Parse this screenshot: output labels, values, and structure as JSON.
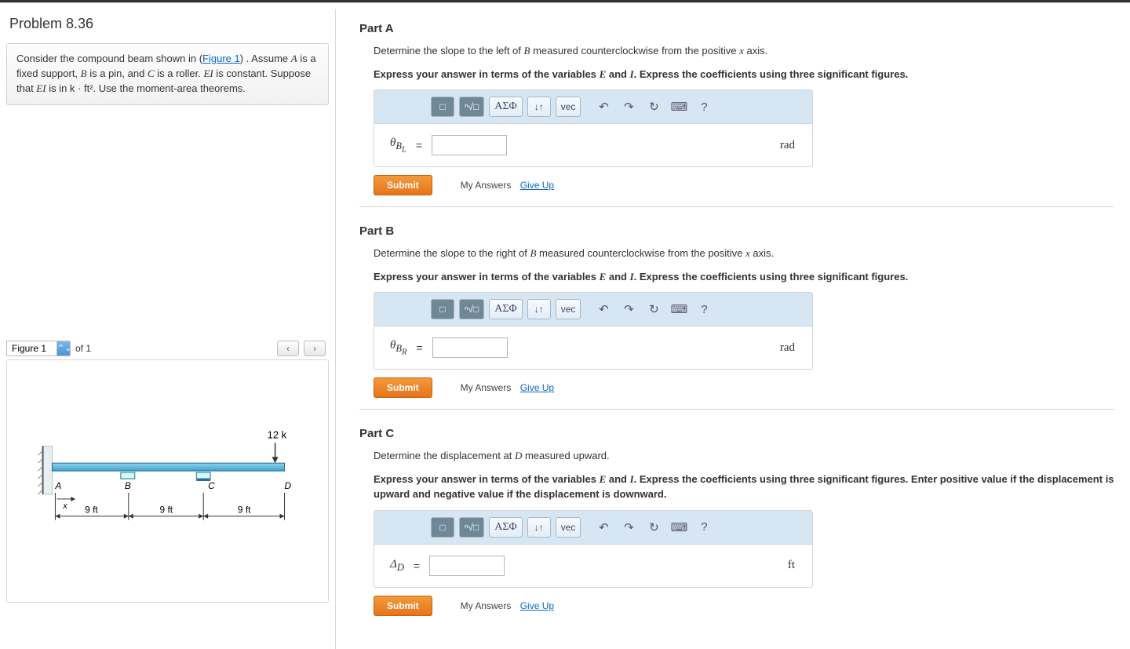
{
  "problem": {
    "title": "Problem 8.36",
    "desc_pre": "Consider the compound beam shown in (",
    "figure_link": "Figure 1",
    "desc_mid": ") . Assume ",
    "A": "A",
    "desc_2": " is a fixed support, ",
    "B": "B",
    "desc_3": " is a pin, and ",
    "C": "C",
    "desc_4": " is a roller. ",
    "EI": "EI",
    "desc_5": " is constant. Suppose that ",
    "desc_6": " is in ",
    "units": "k · ft²",
    "desc_7": ". Use the moment-area theorems."
  },
  "figure_panel": {
    "selector_value": "Figure 1",
    "of_text": "of 1",
    "prev": "‹",
    "next": "›",
    "load_label": "12 k",
    "pt_A": "A",
    "pt_B": "B",
    "pt_C": "C",
    "pt_D": "D",
    "x_lbl": "x",
    "dim1": "9 ft",
    "dim2": "9 ft",
    "dim3": "9 ft"
  },
  "parts": [
    {
      "heading": "Part A",
      "prompt_pre": "Determine the slope to the left of ",
      "prompt_var": "B",
      "prompt_post": " measured counterclockwise from the positive ",
      "prompt_axis": "x",
      "prompt_end": " axis.",
      "instr_pre": "Express your answer in terms of the variables ",
      "instr_v1": "E",
      "instr_mid": " and ",
      "instr_v2": "I",
      "instr_post": ". Express the coefficients using three significant figures.",
      "var_html": "θ",
      "var_sub": "B",
      "var_subsub": "L",
      "unit": "rad"
    },
    {
      "heading": "Part B",
      "prompt_pre": "Determine the slope to the right of ",
      "prompt_var": "B",
      "prompt_post": " measured counterclockwise from the positive ",
      "prompt_axis": "x",
      "prompt_end": " axis.",
      "instr_pre": "Express your answer in terms of the variables ",
      "instr_v1": "E",
      "instr_mid": " and ",
      "instr_v2": "I",
      "instr_post": ". Express the coefficients using three significant figures.",
      "var_html": "θ",
      "var_sub": "B",
      "var_subsub": "R",
      "unit": "rad"
    },
    {
      "heading": "Part C",
      "prompt_pre": "Determine the displacement at ",
      "prompt_var": "D",
      "prompt_post": " measured upward.",
      "prompt_axis": "",
      "prompt_end": "",
      "instr_pre": "Express your answer in terms of the variables ",
      "instr_v1": "E",
      "instr_mid": " and ",
      "instr_v2": "I",
      "instr_post": ". Express the coefficients using three significant figures. Enter positive value if the displacement is upward and negative value if the displacement is downward.",
      "var_html": "Δ",
      "var_sub": "D",
      "var_subsub": "",
      "unit": "ft"
    }
  ],
  "toolbar": {
    "tpl": "□",
    "root": "ⁿ√□",
    "greek": "ΑΣΦ",
    "subsup": "↓↑",
    "vec": "vec",
    "undo": "↶",
    "redo": "↷",
    "reset": "↻",
    "kbd": "⌨",
    "help": "?"
  },
  "submit": {
    "label": "Submit",
    "my_answers": "My Answers",
    "give_up": "Give Up"
  }
}
